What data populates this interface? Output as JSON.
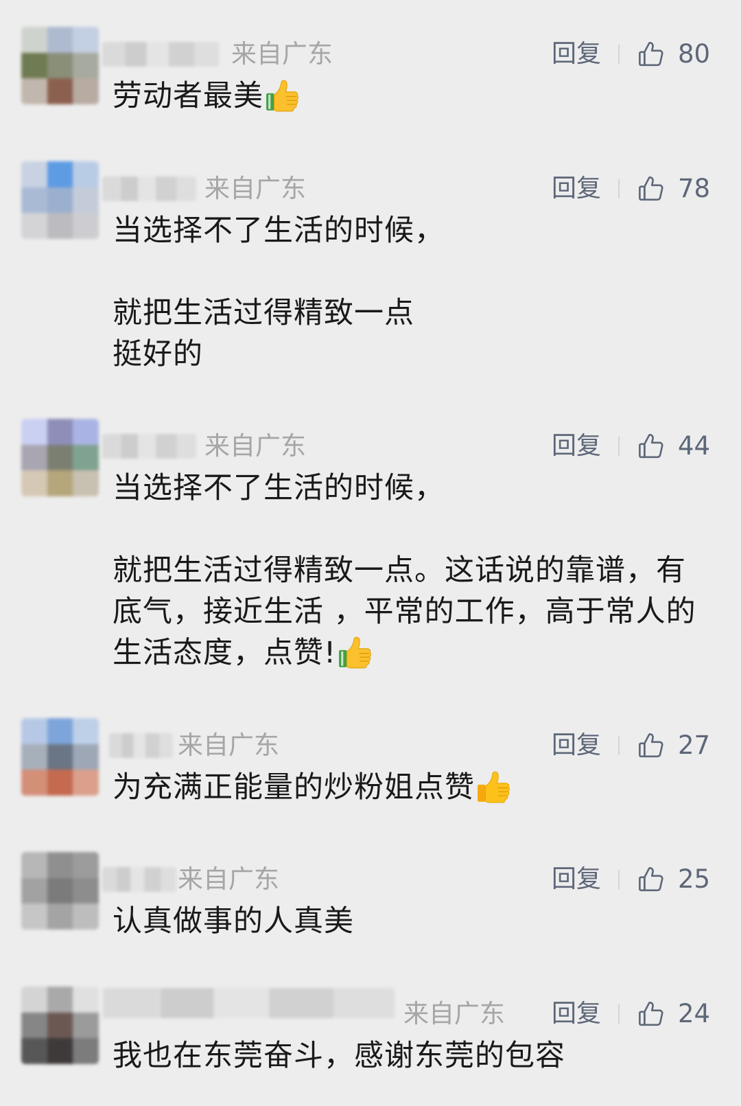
{
  "theme": {
    "background": "#ededed",
    "text": "#191919",
    "meta": "#a6a6a6",
    "action": "#5d6778",
    "divider": "#d4d4d4"
  },
  "icons": {
    "like": "thumbs-up-outline-icon"
  },
  "comments": [
    {
      "location": "来自广东",
      "reply_label": "回复",
      "like_count": "80",
      "paragraphs": [
        [
          "劳动者最美"
        ]
      ],
      "emoji": "wechat-thumbs-up-emoji",
      "avatar_mosaic": [
        "#cfd3cd",
        "#aebad0",
        "#c3cfe2",
        "#6f7b53",
        "#8a8f78",
        "#a7aa9f",
        "#c2b7ae",
        "#8b604f",
        "#b8aba2"
      ]
    },
    {
      "location": "来自广东",
      "reply_label": "回复",
      "like_count": "78",
      "paragraphs": [
        [
          "当选择不了生活的时候，"
        ],
        [
          "就把生活过得精致一点",
          "挺好的"
        ]
      ],
      "avatar_mosaic": [
        "#c8d2e2",
        "#5d9be3",
        "#b9cce6",
        "#a9bad5",
        "#9bb0cf",
        "#c4ccd9",
        "#d4d4d7",
        "#bcbcc0",
        "#cdcdd1"
      ]
    },
    {
      "location": "来自广东",
      "reply_label": "回复",
      "like_count": "44",
      "paragraphs": [
        [
          "当选择不了生活的时候，"
        ],
        [
          "就把生活过得精致一点。这话说的靠谱，有",
          "底气，接近生活 ，平常的工作，高于常人的",
          "生活态度，点赞!"
        ]
      ],
      "emoji": "wechat-thumbs-up-emoji",
      "avatar_mosaic": [
        "#c9d0f2",
        "#8e8eb9",
        "#aab4e4",
        "#a9a5b1",
        "#7b7f72",
        "#80a290",
        "#d5c8b4",
        "#b6a67c",
        "#c8c0b1"
      ]
    },
    {
      "location": "来自广东",
      "reply_label": "回复",
      "like_count": "27",
      "paragraphs": [
        [
          "为充满正能量的炒粉姐点赞"
        ]
      ],
      "emoji": "thumbs-up-emoji",
      "avatar_mosaic": [
        "#b6c8e6",
        "#7ea5da",
        "#bdd0e8",
        "#a7afba",
        "#6a7585",
        "#9ea7b6",
        "#d48f79",
        "#c56a4f",
        "#daa08c"
      ]
    },
    {
      "location": "来自广东",
      "reply_label": "回复",
      "like_count": "25",
      "paragraphs": [
        [
          "认真做事的人真美"
        ]
      ],
      "avatar_mosaic": [
        "#b7b7b7",
        "#8f8f8f",
        "#9c9c9c",
        "#a2a2a2",
        "#7b7b7b",
        "#8d8d8d",
        "#c6c6c6",
        "#a4a4a4",
        "#bdbdbd"
      ]
    },
    {
      "location": "来自广东",
      "reply_label": "回复",
      "like_count": "24",
      "paragraphs": [
        [
          "我也在东莞奋斗，感谢东莞的包容"
        ]
      ],
      "avatar_mosaic": [
        "#d4d4d4",
        "#a9a9a9",
        "#e0e0e0",
        "#868686",
        "#6c5853",
        "#9b9b9b",
        "#575757",
        "#3f3a3a",
        "#7c7c7c"
      ]
    }
  ]
}
